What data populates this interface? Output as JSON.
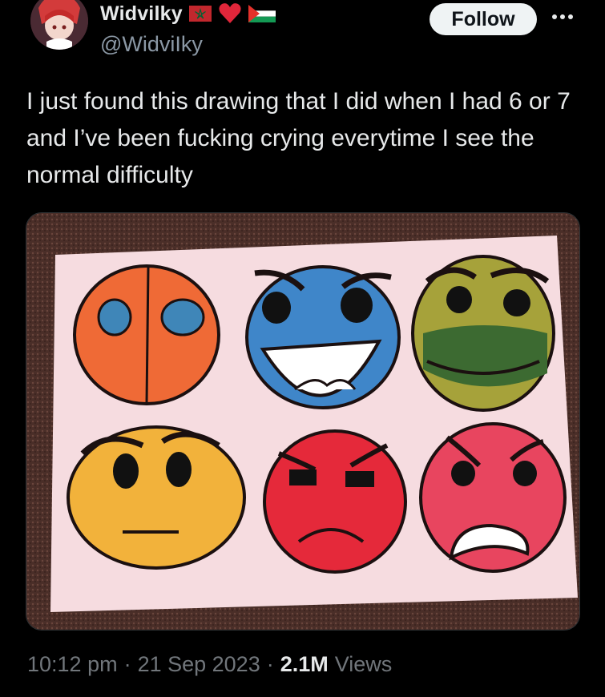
{
  "user": {
    "display_name": "Widvilky",
    "handle": "@WidviIky",
    "avatar_icon": "anime-avatar",
    "badges": [
      "morocco-flag-icon",
      "red-heart-icon",
      "palestine-flag-icon"
    ]
  },
  "actions": {
    "follow_label": "Follow",
    "more_icon": "more-options-icon"
  },
  "tweet": {
    "text": "I just found this drawing that I did when I had 6 or 7 and I’ve been fucking crying everytime I see the normal difficulty",
    "media_description_icon": "drawing-photo",
    "time": "10:12 pm",
    "sep1": "·",
    "date": "21 Sep 2023",
    "sep2": "·",
    "views_count": "2.1M",
    "views_label": "Views"
  },
  "colors": {
    "background": "#000000",
    "text": "#e7e9ea",
    "secondary_text": "#71767b",
    "follow_bg": "#eff3f4"
  }
}
